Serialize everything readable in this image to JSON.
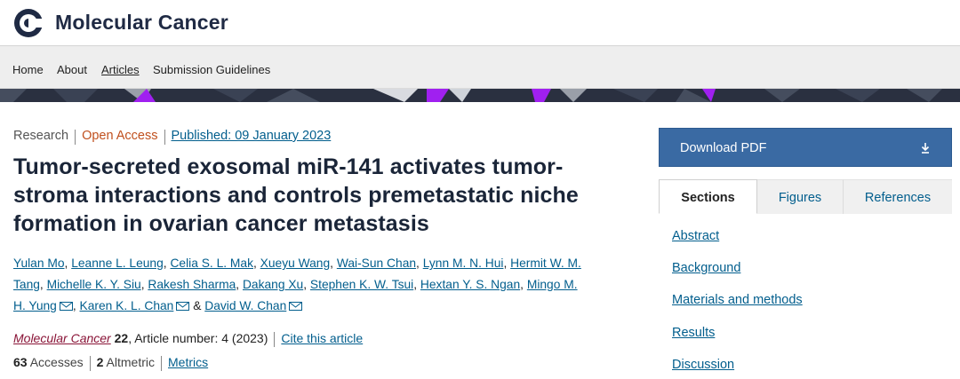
{
  "site": {
    "journal_name": "Molecular Cancer"
  },
  "nav": {
    "items": [
      {
        "label": "Home"
      },
      {
        "label": "About"
      },
      {
        "label": "Articles"
      },
      {
        "label": "Submission Guidelines"
      }
    ]
  },
  "article": {
    "type": "Research",
    "access": "Open Access",
    "published": "Published: 09 January 2023",
    "title": "Tumor-secreted exosomal miR-141 activates tumor-stroma interactions and controls premetastatic niche formation in ovarian cancer metastasis",
    "authors": [
      {
        "name": "Yulan Mo"
      },
      {
        "name": "Leanne L. Leung"
      },
      {
        "name": "Celia S. L. Mak"
      },
      {
        "name": "Xueyu Wang"
      },
      {
        "name": "Wai-Sun Chan"
      },
      {
        "name": "Lynn M. N. Hui"
      },
      {
        "name": "Hermit W. M. Tang"
      },
      {
        "name": "Michelle K. Y. Siu"
      },
      {
        "name": "Rakesh Sharma"
      },
      {
        "name": "Dakang Xu"
      },
      {
        "name": "Stephen K. W. Tsui"
      },
      {
        "name": "Hextan Y. S. Ngan"
      },
      {
        "name": "Mingo M. H. Yung"
      },
      {
        "name": "Karen K. L. Chan"
      },
      {
        "name": "David W. Chan"
      }
    ],
    "author_conjunction": "&",
    "citation": {
      "journal": "Molecular Cancer",
      "volume": "22",
      "article_number": ", Article number: 4 (2023)",
      "cite_link": "Cite this article"
    },
    "metrics": {
      "accesses_count": "63",
      "accesses_label": "Accesses",
      "altmetric_count": "2",
      "altmetric_label": "Altmetric",
      "metrics_link": "Metrics"
    }
  },
  "sidebar": {
    "download_label": "Download PDF",
    "download_icon": "download-arrow-icon",
    "tabs": [
      {
        "label": "Sections"
      },
      {
        "label": "Figures"
      },
      {
        "label": "References"
      }
    ],
    "sections": [
      {
        "label": "Abstract"
      },
      {
        "label": "Background"
      },
      {
        "label": "Materials and methods"
      },
      {
        "label": "Results"
      },
      {
        "label": "Discussion"
      }
    ]
  },
  "colors": {
    "link": "#025e8d",
    "open_access": "#c0501e",
    "journal": "#8a1538",
    "download_button": "#3a6aa3",
    "banner_dark": "#2a3040",
    "banner_accent": "#a020f0"
  }
}
